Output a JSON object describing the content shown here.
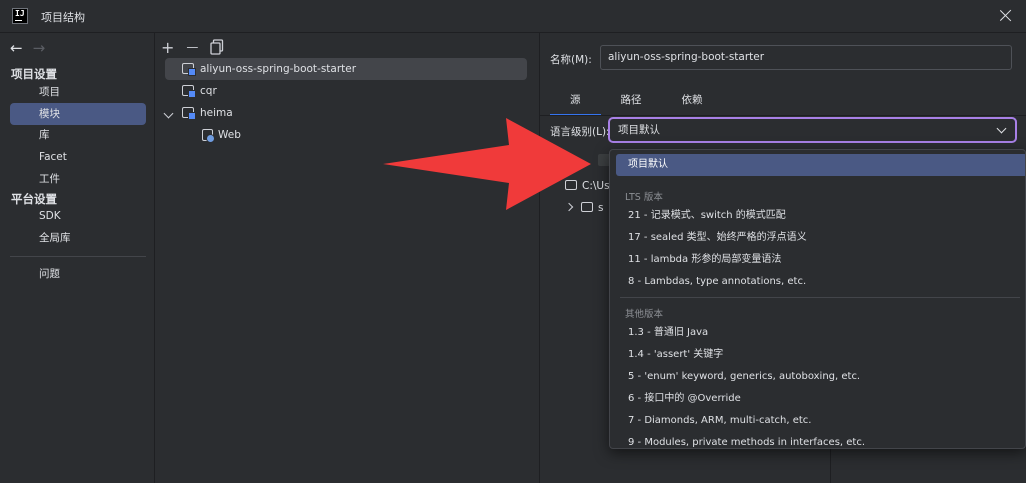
{
  "window": {
    "title": "项目结构",
    "logo_text": "IJ"
  },
  "nav": {
    "back_glyph": "←",
    "forward_glyph": "→"
  },
  "sidebar": {
    "project_settings_title": "项目设置",
    "project_items": [
      "项目",
      "模块",
      "库",
      "Facet",
      "工件"
    ],
    "platform_settings_title": "平台设置",
    "platform_items": [
      "SDK",
      "全局库"
    ],
    "other_items": [
      "问题"
    ],
    "active_item": "模块"
  },
  "toolbar": {
    "add_glyph": "+",
    "remove_glyph": "—"
  },
  "modules": [
    {
      "name": "aliyun-oss-spring-boot-starter",
      "selected": true,
      "expanded": false,
      "depth": 0,
      "icon": "module-folder-icon"
    },
    {
      "name": "cqr",
      "selected": false,
      "expanded": false,
      "depth": 0,
      "icon": "module-folder-icon"
    },
    {
      "name": "heima",
      "selected": false,
      "expanded": true,
      "depth": 0,
      "icon": "module-folder-icon"
    },
    {
      "name": "Web",
      "selected": false,
      "expanded": false,
      "depth": 1,
      "icon": "web-facet-icon"
    }
  ],
  "details": {
    "name_label": "名称(M):",
    "name_value": "aliyun-oss-spring-boot-starter",
    "tabs": [
      "源",
      "路径",
      "依赖"
    ],
    "active_tab": "源",
    "language_level_label": "语言级别(L):",
    "language_level_value": "项目默认",
    "content_root": "C:\\Us",
    "sub_folder": "s"
  },
  "dropdown": {
    "selected": "项目默认",
    "lts_title": "LTS 版本",
    "lts_items": [
      "21 - 记录模式、switch 的模式匹配",
      "17 - sealed 类型、始终严格的浮点语义",
      "11 - lambda 形参的局部变量语法",
      "8 - Lambdas, type annotations, etc."
    ],
    "other_title": "其他版本",
    "other_items": [
      "1.3 - 普通旧 Java",
      "1.4 - 'assert' 关键字",
      "5 - 'enum' keyword, generics, autoboxing, etc.",
      "6 - 接口中的 @Override",
      "7 - Diamonds, ARM, multi-catch, etc.",
      "9 - Modules, private methods in interfaces, etc."
    ]
  },
  "annotation": {
    "arrow_color": "#f03a3a",
    "points_to": "项目默认"
  },
  "colors": {
    "background": "#2b2d30",
    "selection": "#4a5984",
    "accent_blue": "#3574f0",
    "focus_border": "#a880e6"
  }
}
